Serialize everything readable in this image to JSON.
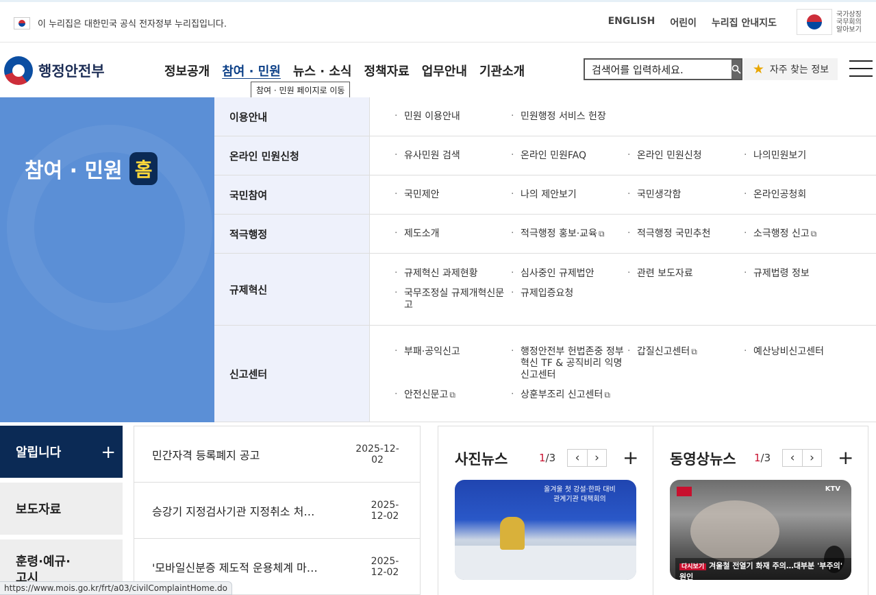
{
  "govbar": {
    "notice": "이 누리집은 대한민국 공식 전자정부 누리집입니다.",
    "links": [
      "ENGLISH",
      "어린이",
      "누리집 안내지도"
    ],
    "symbol_text": "국가상징\n국무회의\n알아보기"
  },
  "header": {
    "logo": "행정안전부",
    "gnb": [
      {
        "label": "정보공개",
        "active": false
      },
      {
        "label": "참여 · 민원",
        "active": true
      },
      {
        "label": "뉴스 · 소식",
        "active": false
      },
      {
        "label": "정책자료",
        "active": false
      },
      {
        "label": "업무안내",
        "active": false
      },
      {
        "label": "기관소개",
        "active": false
      }
    ],
    "tooltip": "참여 · 민원 페이지로 이동",
    "search_value": "검색어를 입력하세요.",
    "favorites": "자주 찾는 정보"
  },
  "mega": {
    "hero_title": "참여 · 민원",
    "hero_badge": "홈",
    "rows": [
      {
        "category": "이용안내",
        "items": [
          {
            "t": "민원 이용안내"
          },
          {
            "t": "민원행정 서비스 헌장"
          }
        ]
      },
      {
        "category": "온라인 민원신청",
        "items": [
          {
            "t": "유사민원 검색"
          },
          {
            "t": "온라인 민원FAQ"
          },
          {
            "t": "온라인 민원신청"
          },
          {
            "t": "나의민원보기"
          }
        ]
      },
      {
        "category": "국민참여",
        "items": [
          {
            "t": "국민제안"
          },
          {
            "t": "나의 제안보기"
          },
          {
            "t": "국민생각함"
          },
          {
            "t": "온라인공청회"
          }
        ]
      },
      {
        "category": "적극행정",
        "items": [
          {
            "t": "제도소개"
          },
          {
            "t": "적극행정 홍보·교육",
            "ext": true
          },
          {
            "t": "적극행정 국민추천"
          },
          {
            "t": "소극행정 신고",
            "ext": true
          }
        ]
      },
      {
        "category": "규제혁신",
        "items": [
          {
            "t": "규제혁신 과제현황"
          },
          {
            "t": "심사중인 규제법안"
          },
          {
            "t": "관련 보도자료"
          },
          {
            "t": "규제법령 정보"
          },
          {
            "t": "국무조정실 규제개혁신문고"
          },
          {
            "t": "규제입증요청"
          }
        ]
      },
      {
        "category": "신고센터",
        "items": [
          {
            "t": "부패·공익신고"
          },
          {
            "t": "행정안전부 헌법존중 정부혁신 TF & 공직비리 익명 신고센터"
          },
          {
            "t": "갑질신고센터",
            "ext": true
          },
          {
            "t": "예산낭비신고센터"
          },
          {
            "t": "안전신문고",
            "ext": true
          },
          {
            "t": "상훈부조리 신고센터",
            "ext": true
          }
        ]
      }
    ],
    "ext_icon": "external-link-icon"
  },
  "tabs": [
    "알립니다",
    "보도자료",
    "훈령·예규·고시"
  ],
  "notices": [
    {
      "title": "민간자격 등록폐지 공고",
      "date": "2025-12-02"
    },
    {
      "title": "승강기 지정검사기관 지정취소 처…",
      "date": "2025-12-02"
    },
    {
      "title": "'모바일신분증 제도적 운용체계 마…",
      "date": "2025-12-02"
    }
  ],
  "photo_news": {
    "title": "사진뉴스",
    "page_current": "1",
    "page_total": "/3",
    "caption": "올겨울 첫 강설·한파 대비\n관계기관 대책회의"
  },
  "video_news": {
    "title": "동영상뉴스",
    "page_current": "1",
    "page_total": "/3",
    "channel": "KTV",
    "subtitle_tag": "다시보기",
    "subtitle": "겨울철 전열기 화재 주의…대부분 '부주의' 원인"
  },
  "status_url": "https://www.mois.go.kr/frt/a03/civilComplaintHome.do"
}
